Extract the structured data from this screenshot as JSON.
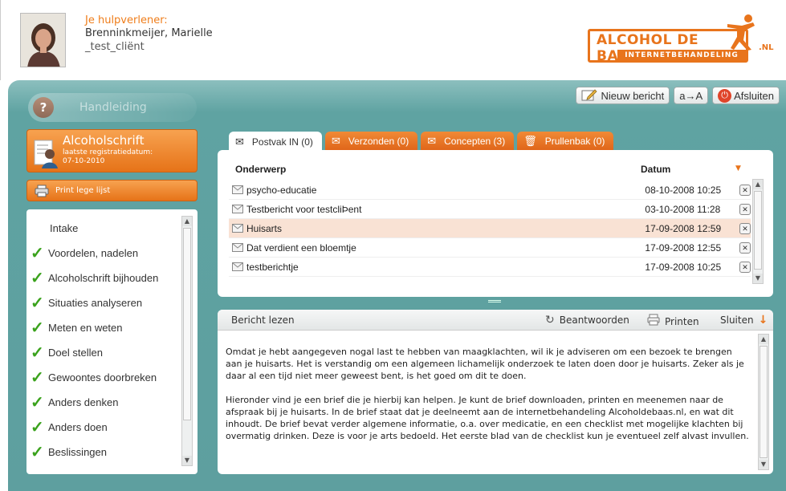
{
  "header": {
    "helper_label": "Je hulpverlener:",
    "helper_name": "Brenninkmeijer, Marielle",
    "client_name": "_test_cliënt",
    "logo_main": "ALCOHOL DE BAAS",
    "logo_sub": "INTERNETBEHANDELING",
    "logo_tld": ".NL"
  },
  "toolbar": {
    "new_message": "Nieuw bericht",
    "font_size": "a→A",
    "close": "Afsluiten"
  },
  "sidebar": {
    "manual": "Handleiding",
    "diary_title": "Alcoholschrift",
    "diary_sub1": "laatste registratiedatum:",
    "diary_sub2": "07-10-2010",
    "print_label": "Print lege lijst",
    "steps": [
      {
        "label": "Intake",
        "done": false
      },
      {
        "label": "Voordelen, nadelen",
        "done": true
      },
      {
        "label": "Alcoholschrift bijhouden",
        "done": true
      },
      {
        "label": "Situaties analyseren",
        "done": true
      },
      {
        "label": "Meten en weten",
        "done": true
      },
      {
        "label": "Doel stellen",
        "done": true
      },
      {
        "label": "Gewoontes doorbreken",
        "done": true
      },
      {
        "label": "Anders denken",
        "done": true
      },
      {
        "label": "Anders doen",
        "done": true
      },
      {
        "label": "Beslissingen",
        "done": true
      }
    ]
  },
  "tabs": [
    {
      "label": "Postvak IN (0)",
      "icon": "inbox-icon"
    },
    {
      "label": "Verzonden (0)",
      "icon": "sent-icon"
    },
    {
      "label": "Concepten (3)",
      "icon": "drafts-icon"
    },
    {
      "label": "Prullenbak (0)",
      "icon": "trash-icon"
    }
  ],
  "messages": {
    "col_subject": "Onderwerp",
    "col_date": "Datum",
    "rows": [
      {
        "subject": "psycho-educatie",
        "date": "08-10-2008 10:25",
        "selected": false
      },
      {
        "subject": "Testbericht voor testcliÞent",
        "date": "03-10-2008 11:28",
        "selected": false
      },
      {
        "subject": "Huisarts",
        "date": "17-09-2008 12:59",
        "selected": true
      },
      {
        "subject": "Dat verdient een bloemtje",
        "date": "17-09-2008 12:55",
        "selected": false
      },
      {
        "subject": "testberichtje",
        "date": "17-09-2008 10:25",
        "selected": false
      }
    ]
  },
  "reader": {
    "title": "Bericht lezen",
    "reply": "Beantwoorden",
    "print": "Printen",
    "close": "Sluiten",
    "paragraphs": [
      "Omdat je hebt aangegeven nogal last te hebben van maagklachten, wil ik je adviseren om een bezoek te brengen aan je huisarts. Het is verstandig om een algemeen lichamelijk onderzoek te laten doen door je huisarts. Zeker als je daar al een tijd niet meer geweest bent, is het goed om dit te doen.",
      "Hieronder vind je een brief die je hierbij kan helpen. Je kunt de brief downloaden, printen en meenemen naar de afspraak bij je huisarts. In de brief staat dat je deelneemt aan de internetbehandeling Alcoholdebaas.nl, en wat dit inhoudt. De brief bevat verder algemene informatie, o.a. over medicatie, en een checklist met mogelijke klachten bij overmatig drinken. Deze is voor je arts bedoeld. Het eerste blad van de checklist kun je eventueel zelf alvast invullen."
    ]
  },
  "colors": {
    "accent": "#e8741c",
    "teal": "#5fa3a2",
    "check": "#3aa21c",
    "selected_row": "#f9e2d4"
  }
}
